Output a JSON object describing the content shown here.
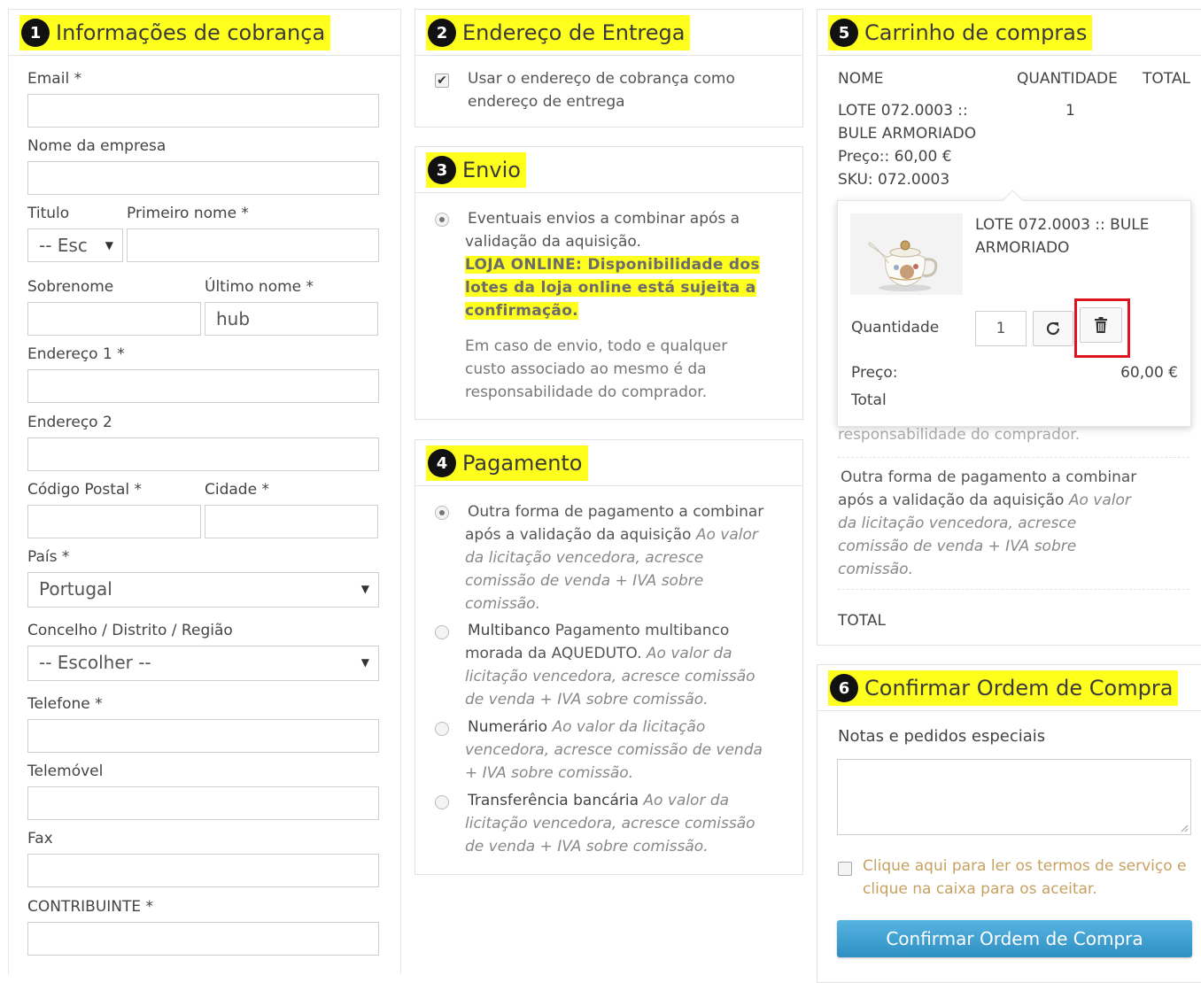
{
  "billing": {
    "num": "1",
    "title": "Informações de cobrança",
    "email_label": "Email *",
    "company_label": "Nome da empresa",
    "title_label": "Titulo",
    "title_select": "-- Esc",
    "first_name_label": "Primeiro nome *",
    "surname_label": "Sobrenome",
    "last_name_label": "Último nome *",
    "last_name_value": "hub",
    "address1_label": "Endereço 1 *",
    "address2_label": "Endereço 2",
    "postal_label": "Código Postal *",
    "city_label": "Cidade *",
    "country_label": "País *",
    "country_value": "Portugal",
    "region_label": "Concelho / Distrito / Região",
    "region_value": "-- Escolher --",
    "phone_label": "Telefone *",
    "mobile_label": "Telemóvel",
    "fax_label": "Fax",
    "taxpayer_label": "CONTRIBUINTE *"
  },
  "shipping_address": {
    "num": "2",
    "title": "Endereço de Entrega",
    "same_line1": "Usar o endereço de cobrança como",
    "same_line2": "endereço de entrega"
  },
  "shipping": {
    "num": "3",
    "title": "Envio",
    "option_line1": "Eventuais envios a combinar após a",
    "option_line2": "validação da aquisição.",
    "notice_line1": "LOJA ONLINE: Disponibilidade dos",
    "notice_line2": "lotes da loja online está sujeita a",
    "notice_line3": "confirmação.",
    "cost_line1": "Em caso de envio, todo e qualquer",
    "cost_line2": "custo associado ao mesmo é da",
    "cost_line3": "responsabilidade do comprador."
  },
  "payment": {
    "num": "4",
    "title": "Pagamento",
    "opt1_l1": "Outra forma de pagamento a combinar",
    "opt1_l2a": "após a validação da aquisição",
    "opt1_l2b": "Ao valor",
    "opt1_l3": "da licitação vencedora, acresce",
    "opt1_l4": "comissão de venda + IVA sobre",
    "opt1_l5": "comissão.",
    "opt2_name": "Multibanco",
    "opt2_l1b": "Pagamento multibanco",
    "opt2_l2a": "morada da AQUEDUTO.",
    "opt2_l2b": "Ao valor da",
    "opt2_l3": "licitação vencedora, acresce comissão",
    "opt2_l4": "de venda + IVA sobre comissão.",
    "opt3_name": "Numerário",
    "opt3_l1b": "Ao valor da licitação",
    "opt3_l2": "vencedora, acresce comissão de venda",
    "opt3_l3": "+ IVA sobre comissão.",
    "opt4_name": "Transferência bancária",
    "opt4_l1b": "Ao valor da",
    "opt4_l2": "licitação vencedora, acresce comissão",
    "opt4_l3": "de venda + IVA sobre comissão."
  },
  "cart": {
    "num": "5",
    "title": "Carrinho de compras",
    "col_name": "NOME",
    "col_qty": "QUANTIDADE",
    "col_total": "TOTAL",
    "item_l1": "LOTE 072.0003 ::",
    "item_l2": "BULE ARMORIADO",
    "item_price": "Preço:: 60,00 €",
    "item_sku": "SKU: 072.0003",
    "item_qty": "1",
    "popup": {
      "name_l1": "LOTE 072.0003 :: BULE",
      "name_l2": "ARMORIADO",
      "qty_label": "Quantidade",
      "qty_value": "1",
      "price_label": "Preço:",
      "price_value": "60,00 €",
      "total_label": "Total"
    },
    "behind_text": "responsabilidade do comprador.",
    "pay_l1": "Outra forma de pagamento a combinar",
    "pay_l2a": "após a validação da aquisição",
    "pay_l2b": "Ao valor",
    "pay_l3": "da licitação vencedora, acresce",
    "pay_l4": "comissão de venda + IVA sobre",
    "pay_l5": "comissão.",
    "total_label": "TOTAL"
  },
  "confirm": {
    "num": "6",
    "title": "Confirmar Ordem de Compra",
    "notes_label": "Notas e pedidos especiais",
    "terms_l1": "Clique aqui para ler os termos de serviço e",
    "terms_l2": "clique na caixa para os aceitar.",
    "button": "Confirmar Ordem de Compra"
  },
  "colors": {
    "highlight": "#ffff1e",
    "confirm_button": "#3a9fd0",
    "delete_outline": "#e0141e",
    "terms_text": "#c8a060"
  }
}
